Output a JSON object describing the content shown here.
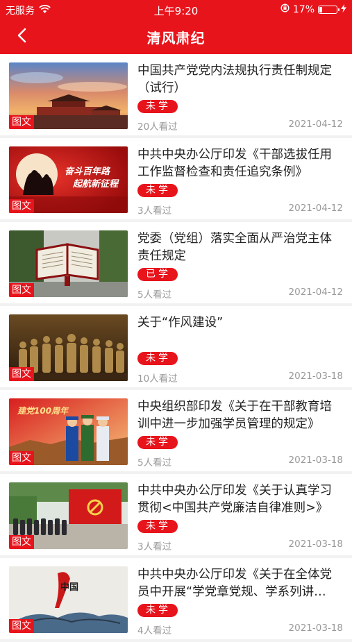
{
  "status_bar": {
    "carrier": "无服务",
    "time": "上午9:20",
    "battery": "17%",
    "battery_level": 0.17
  },
  "nav": {
    "title": "清风肃纪",
    "back_icon": "chevron-left-icon"
  },
  "articles": [
    {
      "title": "中国共产党党内法规执行责任制规定（试行）",
      "status": "未学",
      "views": "20人看过",
      "date": "2021-04-12",
      "thumb_tag": "图文"
    },
    {
      "title": "中共中央办公厅印发《干部选拔任用工作监督检查和责任追究条例》",
      "status": "未学",
      "views": "3人看过",
      "date": "2021-04-12",
      "thumb_tag": "图文",
      "thumb_text_1": "奋斗百年路",
      "thumb_text_2": "起航新征程"
    },
    {
      "title": "党委（党组）落实全面从严治党主体责任规定",
      "status": "已学",
      "views": "5人看过",
      "date": "2021-04-12",
      "thumb_tag": "图文"
    },
    {
      "title": "关于“作风建设”",
      "status": "未学",
      "views": "10人看过",
      "date": "2021-03-18",
      "thumb_tag": "图文"
    },
    {
      "title": "中央组织部印发《关于在干部教育培训中进一步加强学员管理的规定》",
      "status": "未学",
      "views": "5人看过",
      "date": "2021-03-18",
      "thumb_tag": "图文",
      "thumb_text_1": "建党100周年"
    },
    {
      "title": "中共中央办公厅印发《关于认真学习贯彻<中国共产党廉洁自律准则>》",
      "status": "未学",
      "views": "3人看过",
      "date": "2021-03-18",
      "thumb_tag": "图文"
    },
    {
      "title": "中共中央办公厅印发《关于在全体党员中开展“学党章党规、学系列讲话，做合格党员”》",
      "status": "未学",
      "views": "4人看过",
      "date": "2021-03-18",
      "thumb_tag": "图文",
      "thumb_text_1": "中国"
    }
  ]
}
